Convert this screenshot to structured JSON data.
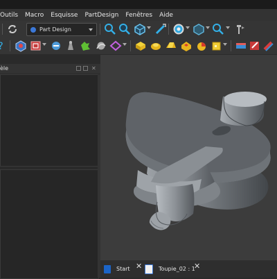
{
  "menu": {
    "items": [
      "Outils",
      "Macro",
      "Esquisse",
      "PartDesign",
      "Fenêtres",
      "Aide"
    ]
  },
  "toolbar": {
    "workbench_selected": "Part Design"
  },
  "left_panel": {
    "title_partial": "èle"
  },
  "tabs": [
    {
      "label": "Start",
      "close": "✕"
    },
    {
      "label": "Toupie_02 : 1",
      "close": "✕"
    }
  ],
  "viewport": {
    "model_color": "#8e9196"
  }
}
